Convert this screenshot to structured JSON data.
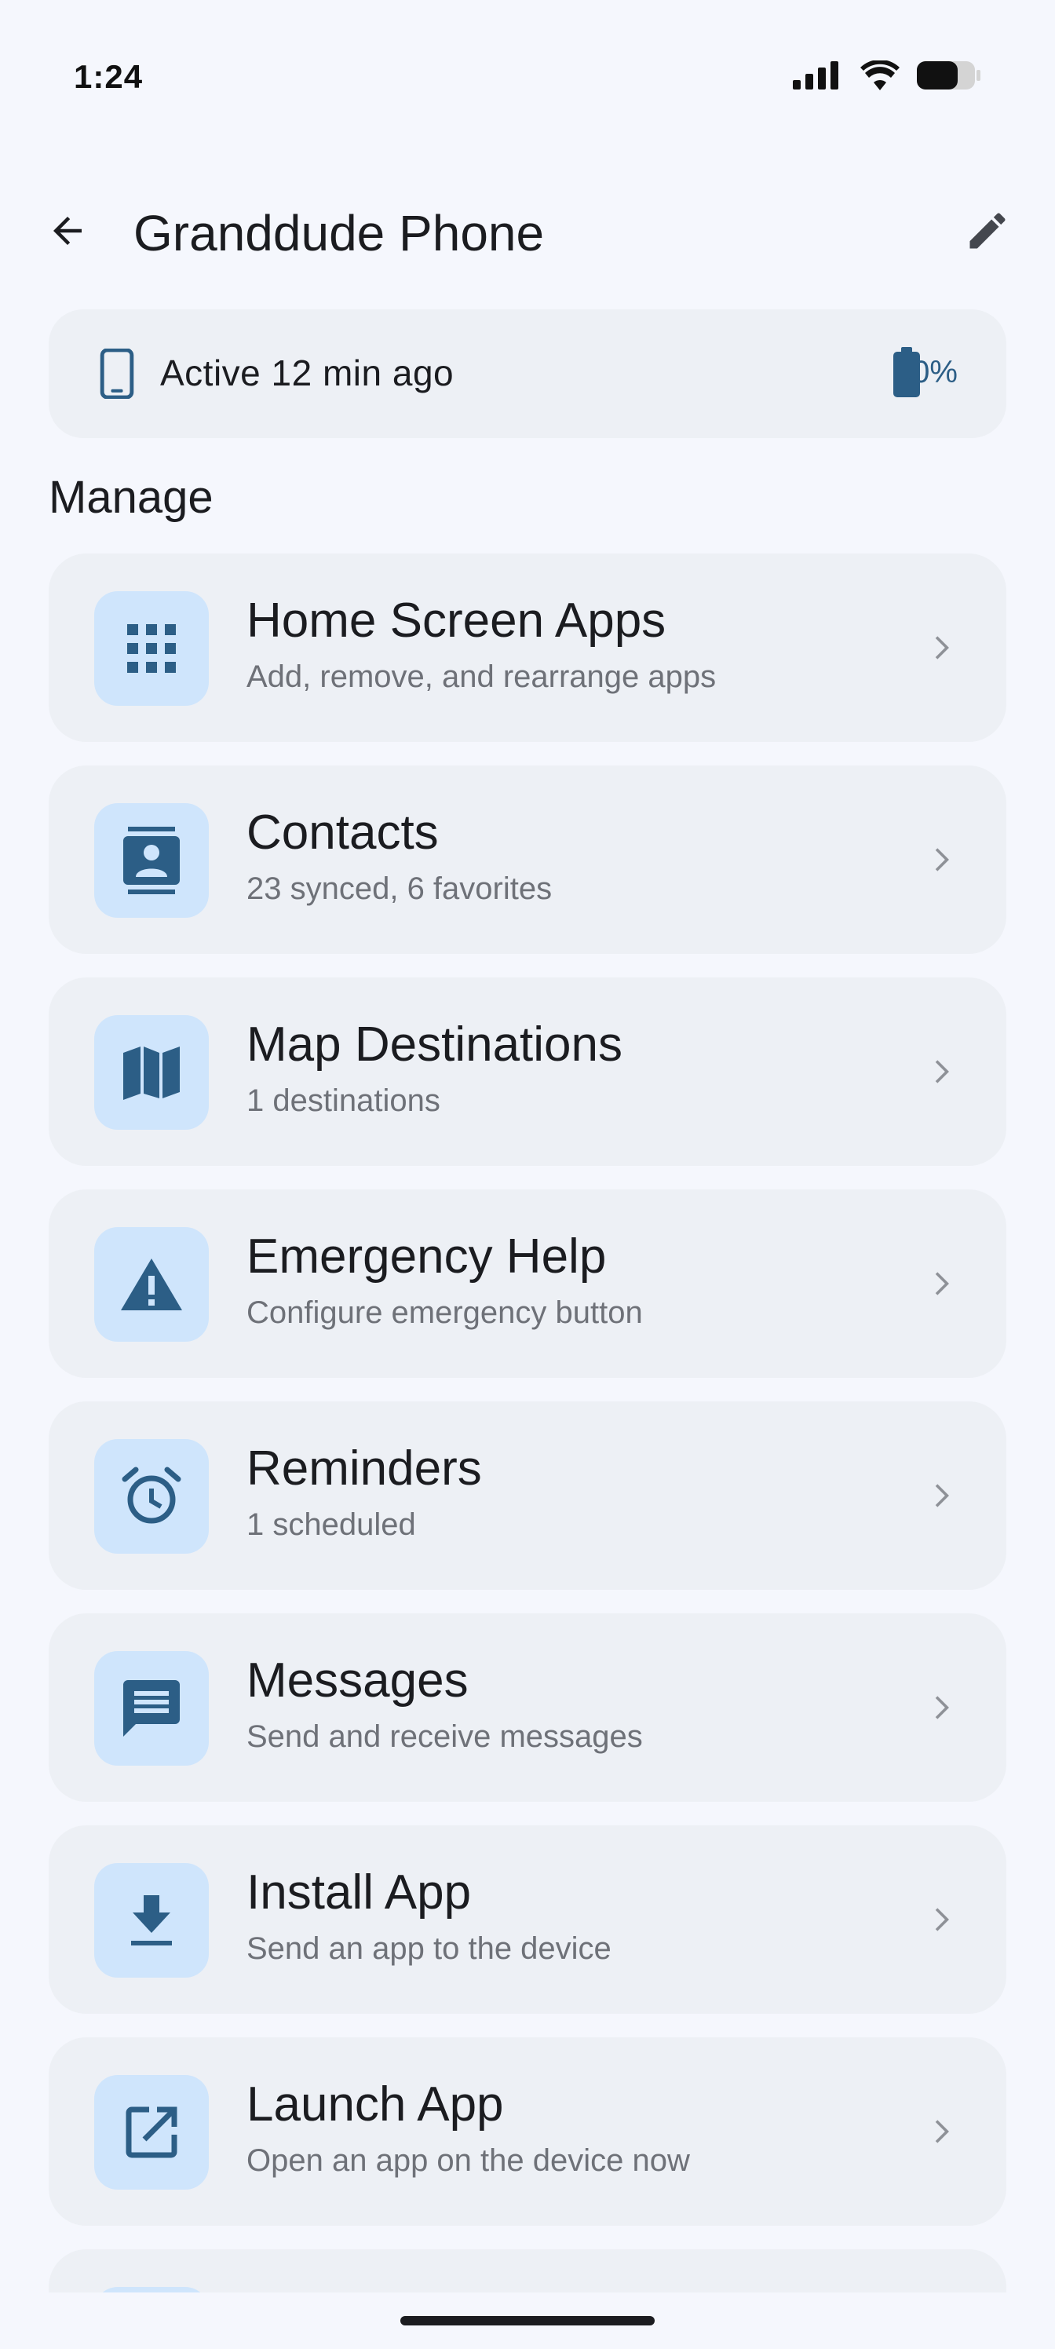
{
  "status_bar": {
    "time": "1:24"
  },
  "app_bar": {
    "title": "Granddude Phone"
  },
  "device_status": {
    "active_text": "Active 12 min ago",
    "battery": "90%"
  },
  "section_title": "Manage",
  "items": [
    {
      "title": "Home Screen Apps",
      "subtitle": "Add, remove, and rearrange apps",
      "icon": "apps-grid-icon"
    },
    {
      "title": "Contacts",
      "subtitle": "23 synced, 6 favorites",
      "icon": "contacts-icon"
    },
    {
      "title": "Map Destinations",
      "subtitle": "1 destinations",
      "icon": "map-icon"
    },
    {
      "title": "Emergency Help",
      "subtitle": "Configure emergency button",
      "icon": "warning-icon"
    },
    {
      "title": "Reminders",
      "subtitle": "1 scheduled",
      "icon": "alarm-icon"
    },
    {
      "title": "Messages",
      "subtitle": "Send and receive messages",
      "icon": "message-icon"
    },
    {
      "title": "Install App",
      "subtitle": "Send an app to the device",
      "icon": "download-icon"
    },
    {
      "title": "Launch App",
      "subtitle": "Open an app on the device now",
      "icon": "open-external-icon"
    }
  ],
  "colors": {
    "background": "#f5f7fd",
    "card": "#edf0f5",
    "icon_tile": "#cfe5fc",
    "icon": "#2c5e86"
  }
}
